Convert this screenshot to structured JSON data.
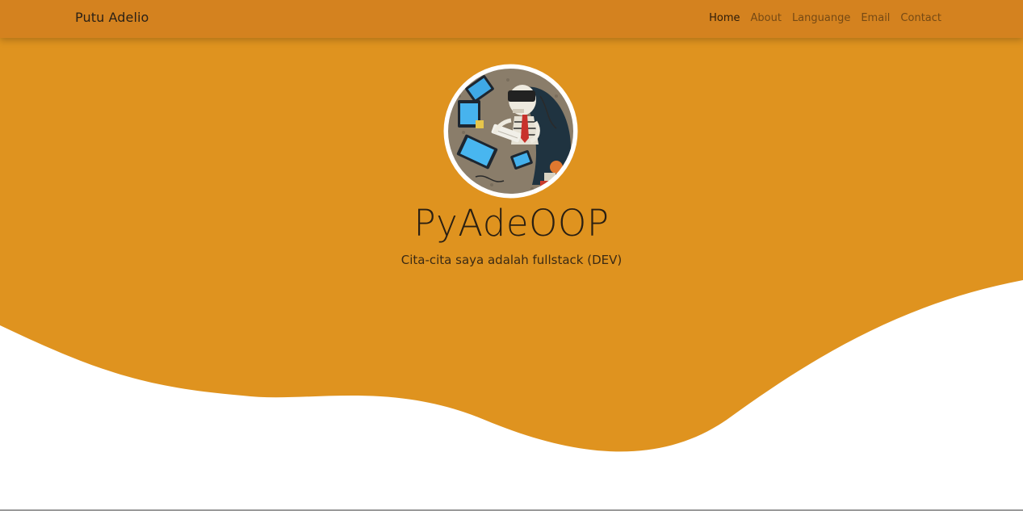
{
  "navbar": {
    "brand": "Putu Adelio",
    "links": [
      {
        "label": "Home",
        "active": true
      },
      {
        "label": "About",
        "active": false
      },
      {
        "label": "Languange",
        "active": false
      },
      {
        "label": "Email",
        "active": false
      },
      {
        "label": "Contact",
        "active": false
      }
    ]
  },
  "hero": {
    "title": "PyAdeOOP",
    "subtitle": "Cita-cita saya adalah fullstack (DEV)",
    "avatar_icon": "skeleton-vr-programmer-illustration"
  },
  "colors": {
    "navbar": "#d4821f",
    "hero": "#df931f",
    "background": "#ffffff"
  }
}
